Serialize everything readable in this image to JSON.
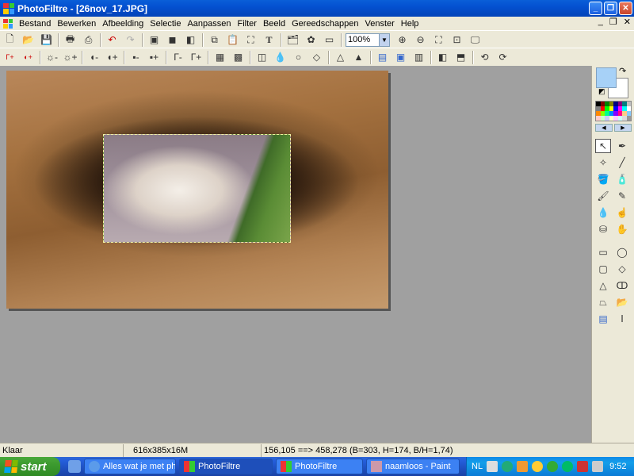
{
  "window": {
    "title": "PhotoFiltre - [26nov_17.JPG]"
  },
  "menu": {
    "items": [
      "Bestand",
      "Bewerken",
      "Afbeelding",
      "Selectie",
      "Aanpassen",
      "Filter",
      "Beeld",
      "Gereedschappen",
      "Venster",
      "Help"
    ]
  },
  "toolbar": {
    "zoom_value": "100%",
    "text_tool_glyph": "T"
  },
  "status": {
    "left": "Klaar",
    "dimensions": "616x385x16M",
    "coords": "156,105 ==> 458,278 (B=303, H=174, B/H=1,74)"
  },
  "taskbar": {
    "start_label": "start",
    "tasks": [
      "Alles wat je met pho...",
      "PhotoFiltre",
      "PhotoFiltre",
      "naamloos - Paint"
    ],
    "lang": "NL",
    "clock": "9:52"
  },
  "colors": {
    "foreground": "#a7d1f7",
    "background": "#ffffff",
    "titlebar": "#0450d0",
    "workspace": "#a0a0a0"
  }
}
